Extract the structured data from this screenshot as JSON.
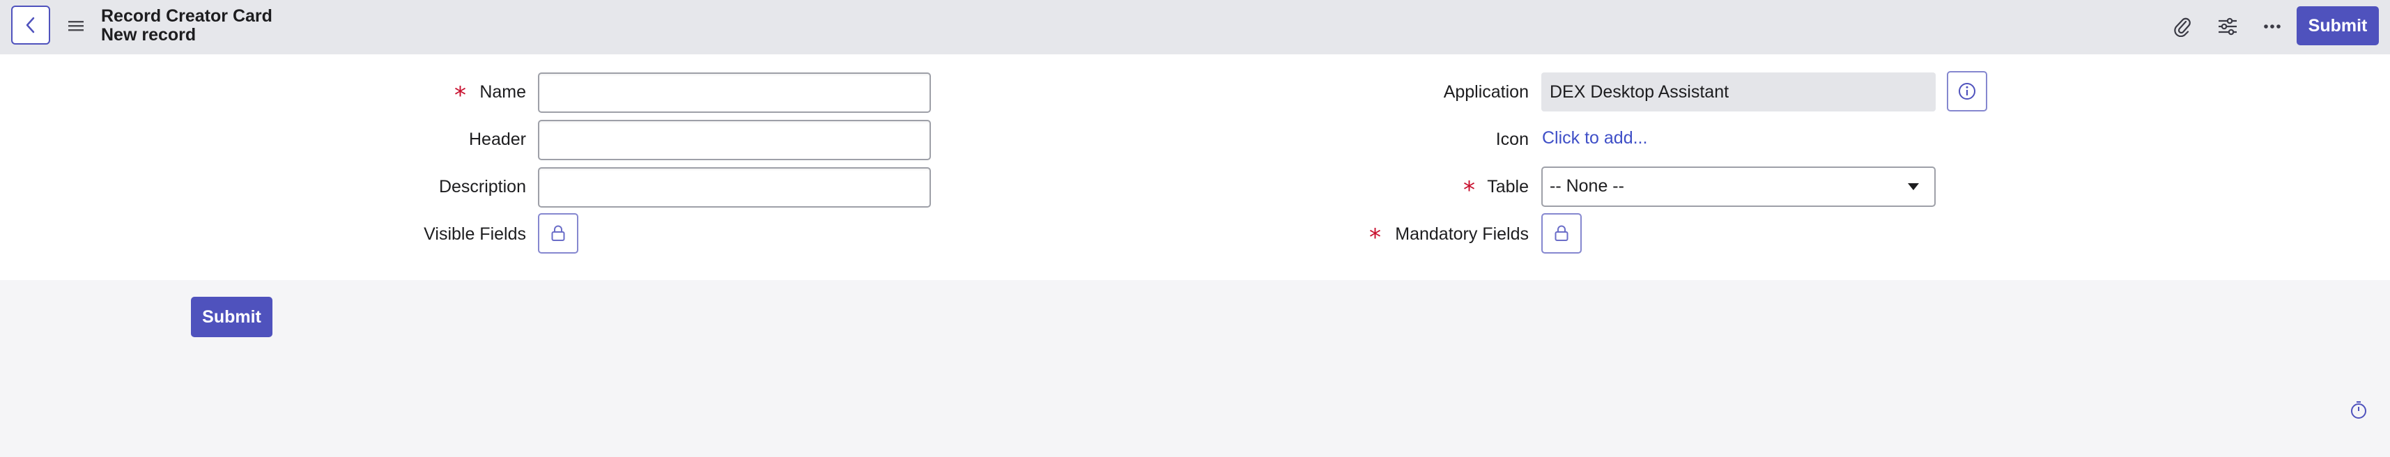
{
  "header": {
    "title": "Record Creator Card",
    "subtitle": "New record",
    "back_icon": "chevron-left-icon",
    "menu_icon": "hamburger-icon",
    "actions": [
      "paperclip-icon",
      "sliders-icon",
      "more-icon"
    ],
    "submit_label": "Submit"
  },
  "form": {
    "left": {
      "name_label": "Name",
      "name_value": "",
      "header_label": "Header",
      "header_value": "",
      "description_label": "Description",
      "description_value": "",
      "visible_fields_label": "Visible Fields"
    },
    "right": {
      "application_label": "Application",
      "application_value": "DEX Desktop Assistant",
      "icon_label": "Icon",
      "icon_link": "Click to add...",
      "table_label": "Table",
      "table_value": "-- None --",
      "mandatory_fields_label": "Mandatory Fields"
    },
    "required_marker": "*"
  },
  "footer": {
    "submit_label": "Submit"
  },
  "colors": {
    "accent": "#4f52bd",
    "required": "#c8102e",
    "link": "#3f4fc7",
    "header_bg": "#e6e7eb"
  }
}
